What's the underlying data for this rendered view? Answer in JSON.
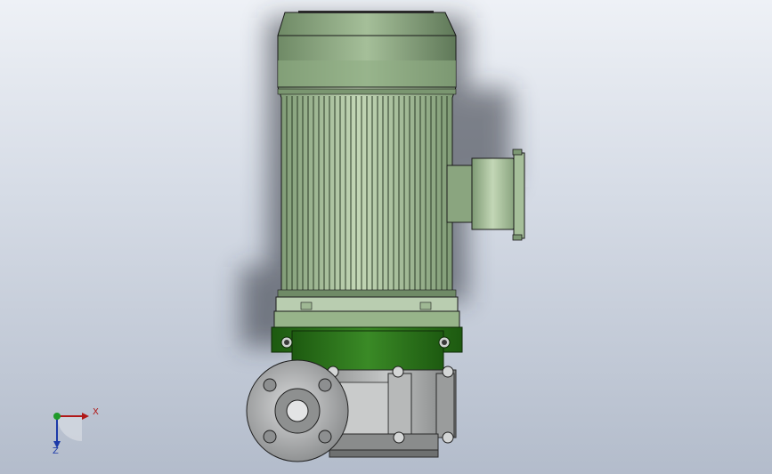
{
  "viewport": {
    "background_top": "#eef1f6",
    "background_bottom": "#b3bccb"
  },
  "model": {
    "motor_color": "#9fb894",
    "pump_bracket_color": "#2f7a1e",
    "pump_casing_color": "#a9abab"
  },
  "triad": {
    "x_label": "X",
    "z_label": "Z",
    "x_color": "#b01818",
    "y_color": "#1f9a2a",
    "z_color": "#1c3aa8"
  }
}
